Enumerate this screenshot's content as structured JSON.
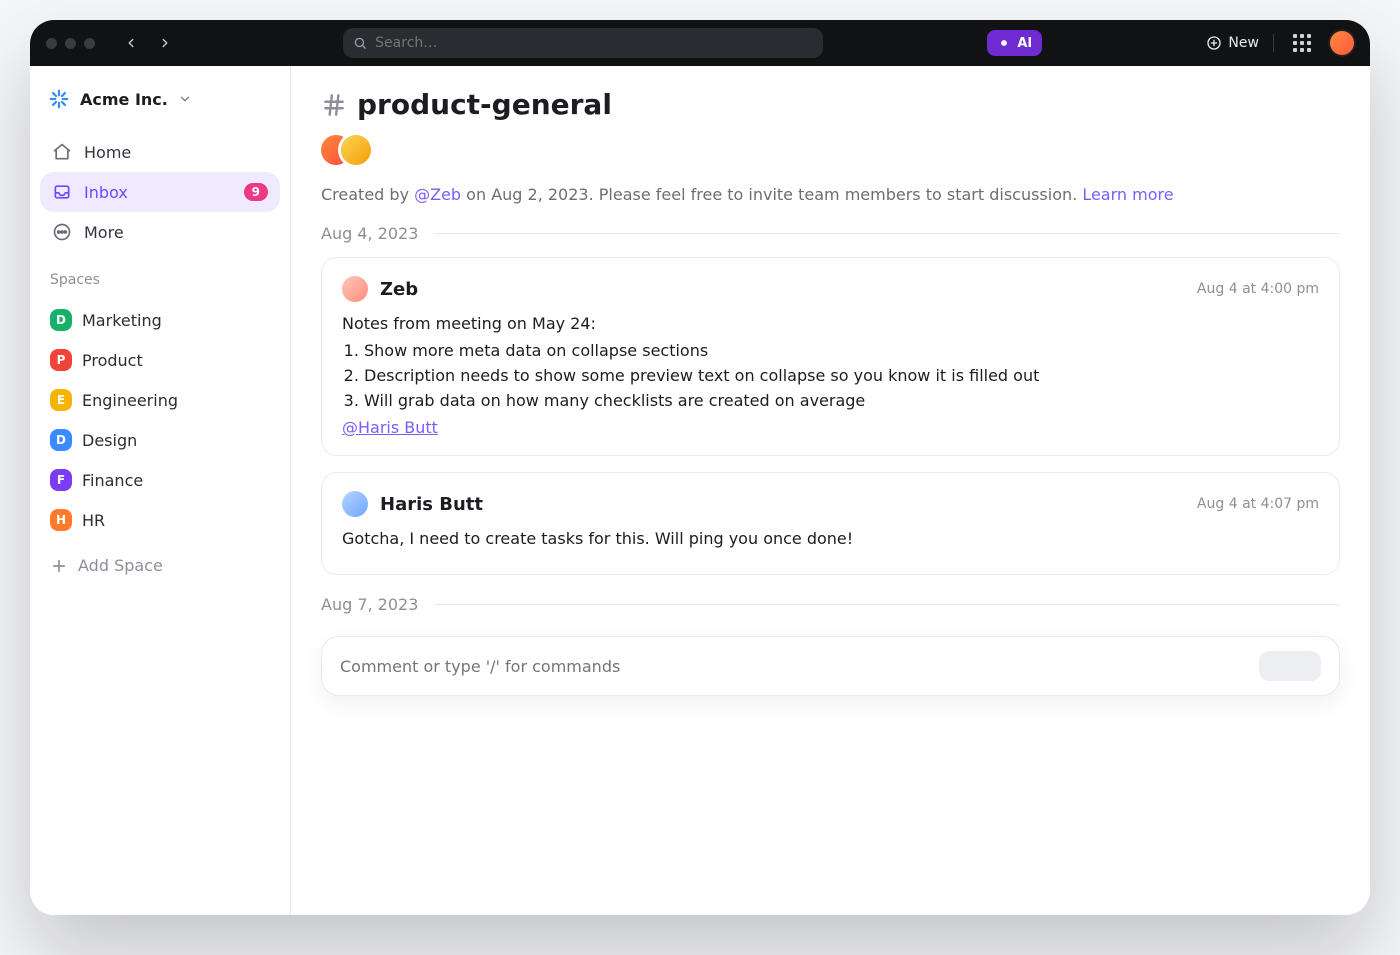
{
  "topbar": {
    "search_placeholder": "Search…",
    "ai_label": "AI",
    "new_label": "New"
  },
  "workspace": {
    "name": "Acme Inc."
  },
  "sidebar": {
    "items": [
      {
        "icon": "home",
        "label": "Home",
        "active": false
      },
      {
        "icon": "inbox",
        "label": "Inbox",
        "active": true,
        "badge": "9"
      },
      {
        "icon": "more",
        "label": "More",
        "active": false
      }
    ],
    "section_title": "Spaces",
    "spaces": [
      {
        "letter": "D",
        "name": "Marketing",
        "color": "#17b26a"
      },
      {
        "letter": "P",
        "name": "Product",
        "color": "#f0443b"
      },
      {
        "letter": "E",
        "name": "Engineering",
        "color": "#f4b400"
      },
      {
        "letter": "D",
        "name": "Design",
        "color": "#3a8bff"
      },
      {
        "letter": "F",
        "name": "Finance",
        "color": "#7a3df2"
      },
      {
        "letter": "H",
        "name": "HR",
        "color": "#ff7a2a"
      }
    ],
    "add_space_label": "Add Space"
  },
  "channel": {
    "name": "product-general",
    "created_prefix": "Created by ",
    "creator": "@Zeb",
    "created_suffix": " on Aug 2, 2023. Please feel free to invite team members to start discussion. ",
    "learn_more": "Learn more",
    "dividers": [
      "Aug 4, 2023",
      "Aug 7, 2023"
    ],
    "messages": [
      {
        "author": "Zeb",
        "time": "Aug 4 at 4:00 pm",
        "lead": "Notes from meeting on May 24:",
        "items": [
          "Show more meta data on collapse sections",
          "Description needs to show some preview text on collapse so you know it is filled out",
          "Will grab data on how many checklists are created on average"
        ],
        "mention": "@Haris Butt"
      },
      {
        "author": "Haris Butt",
        "time": "Aug 4 at 4:07 pm",
        "body": "Gotcha, I need to create tasks for this. Will ping you once done!"
      }
    ],
    "composer_placeholder": "Comment or type '/' for commands"
  }
}
